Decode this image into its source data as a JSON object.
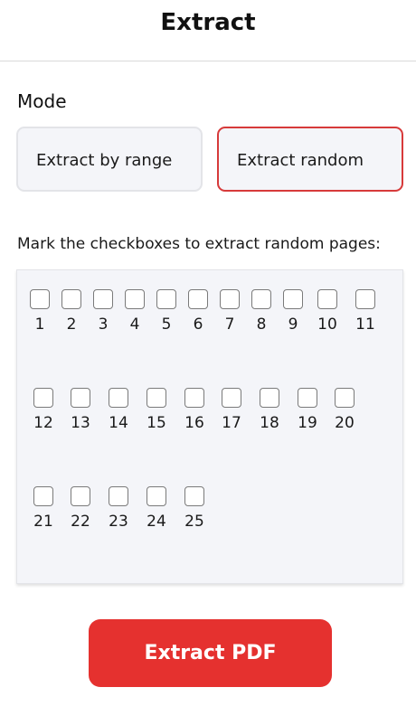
{
  "header": {
    "title": "Extract"
  },
  "mode": {
    "label": "Mode",
    "options": [
      {
        "label": "Extract by range",
        "selected": false
      },
      {
        "label": "Extract random",
        "selected": true
      }
    ]
  },
  "hint": "Mark the checkboxes to extract random pages:",
  "pages": [
    {
      "label": "1",
      "checked": false
    },
    {
      "label": "2",
      "checked": false
    },
    {
      "label": "3",
      "checked": false
    },
    {
      "label": "4",
      "checked": false
    },
    {
      "label": "5",
      "checked": false
    },
    {
      "label": "6",
      "checked": false
    },
    {
      "label": "7",
      "checked": false
    },
    {
      "label": "8",
      "checked": false
    },
    {
      "label": "9",
      "checked": false
    },
    {
      "label": "10",
      "checked": false
    },
    {
      "label": "11",
      "checked": false
    },
    {
      "label": "12",
      "checked": false
    },
    {
      "label": "13",
      "checked": false
    },
    {
      "label": "14",
      "checked": false
    },
    {
      "label": "15",
      "checked": false
    },
    {
      "label": "16",
      "checked": false
    },
    {
      "label": "17",
      "checked": false
    },
    {
      "label": "18",
      "checked": false
    },
    {
      "label": "19",
      "checked": false
    },
    {
      "label": "20",
      "checked": false
    },
    {
      "label": "21",
      "checked": false
    },
    {
      "label": "22",
      "checked": false
    },
    {
      "label": "23",
      "checked": false
    },
    {
      "label": "24",
      "checked": false
    },
    {
      "label": "25",
      "checked": false
    }
  ],
  "action": {
    "label": "Extract PDF"
  },
  "colors": {
    "accent": "#e5312f",
    "selected_border": "#d73a3a",
    "panel_bg": "#f4f5f9"
  }
}
